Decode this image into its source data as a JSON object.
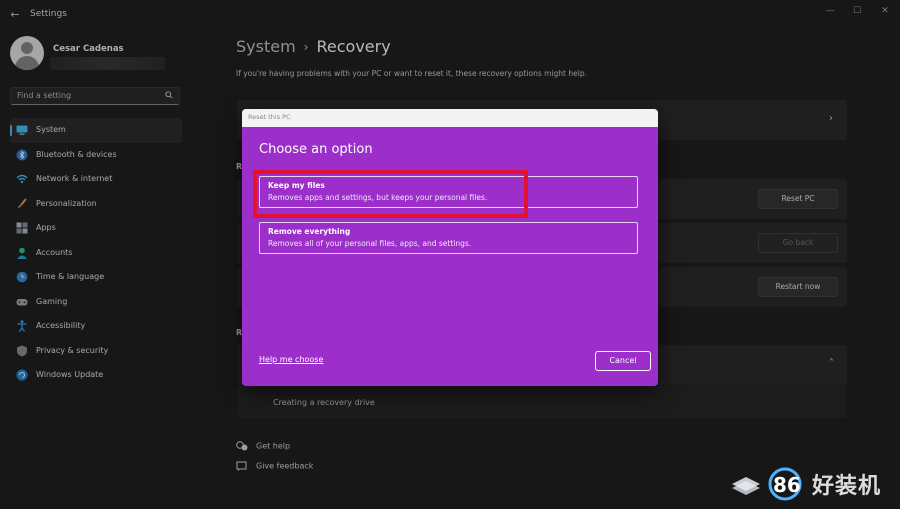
{
  "window": {
    "title": "Settings",
    "back_icon": "back-arrow-icon",
    "controls": [
      "minimize",
      "maximize",
      "close"
    ]
  },
  "user": {
    "name": "Cesar Cadenas"
  },
  "search": {
    "placeholder": "Find a setting"
  },
  "sidebar": {
    "items": [
      {
        "label": "System",
        "icon": "monitor-icon",
        "active": true
      },
      {
        "label": "Bluetooth & devices",
        "icon": "bluetooth-icon"
      },
      {
        "label": "Network & internet",
        "icon": "wifi-icon"
      },
      {
        "label": "Personalization",
        "icon": "brush-icon"
      },
      {
        "label": "Apps",
        "icon": "apps-icon"
      },
      {
        "label": "Accounts",
        "icon": "person-icon"
      },
      {
        "label": "Time & language",
        "icon": "globe-clock-icon"
      },
      {
        "label": "Gaming",
        "icon": "gamepad-icon"
      },
      {
        "label": "Accessibility",
        "icon": "accessibility-icon"
      },
      {
        "label": "Privacy & security",
        "icon": "shield-icon"
      },
      {
        "label": "Windows Update",
        "icon": "update-icon"
      }
    ]
  },
  "main": {
    "breadcrumb": {
      "parent": "System",
      "separator": "›",
      "current": "Recovery"
    },
    "intro": "If you're having problems with your PC or want to reset it, these recovery options might help.",
    "section_letter_1": "R",
    "section_letter_2": "R",
    "buttons": {
      "reset_pc": "Reset PC",
      "go_back": "Go back",
      "restart_now": "Restart now"
    },
    "recovery_drive": "Creating a recovery drive",
    "help": [
      {
        "label": "Get help",
        "icon": "help-chat-icon"
      },
      {
        "label": "Give feedback",
        "icon": "feedback-icon"
      }
    ]
  },
  "dialog": {
    "bar_title": "Reset this PC",
    "heading": "Choose an option",
    "options": [
      {
        "title": "Keep my files",
        "desc": "Removes apps and settings, but keeps your personal files."
      },
      {
        "title": "Remove everything",
        "desc": "Removes all of your personal files, apps, and settings."
      }
    ],
    "help_link": "Help me choose",
    "cancel": "Cancel"
  },
  "watermark": {
    "text": "好装机"
  },
  "colors": {
    "accent": "#4cc2ff",
    "dialog_bg": "#9c2fc9",
    "highlight": "#e4112e",
    "app_bg": "#202020"
  }
}
